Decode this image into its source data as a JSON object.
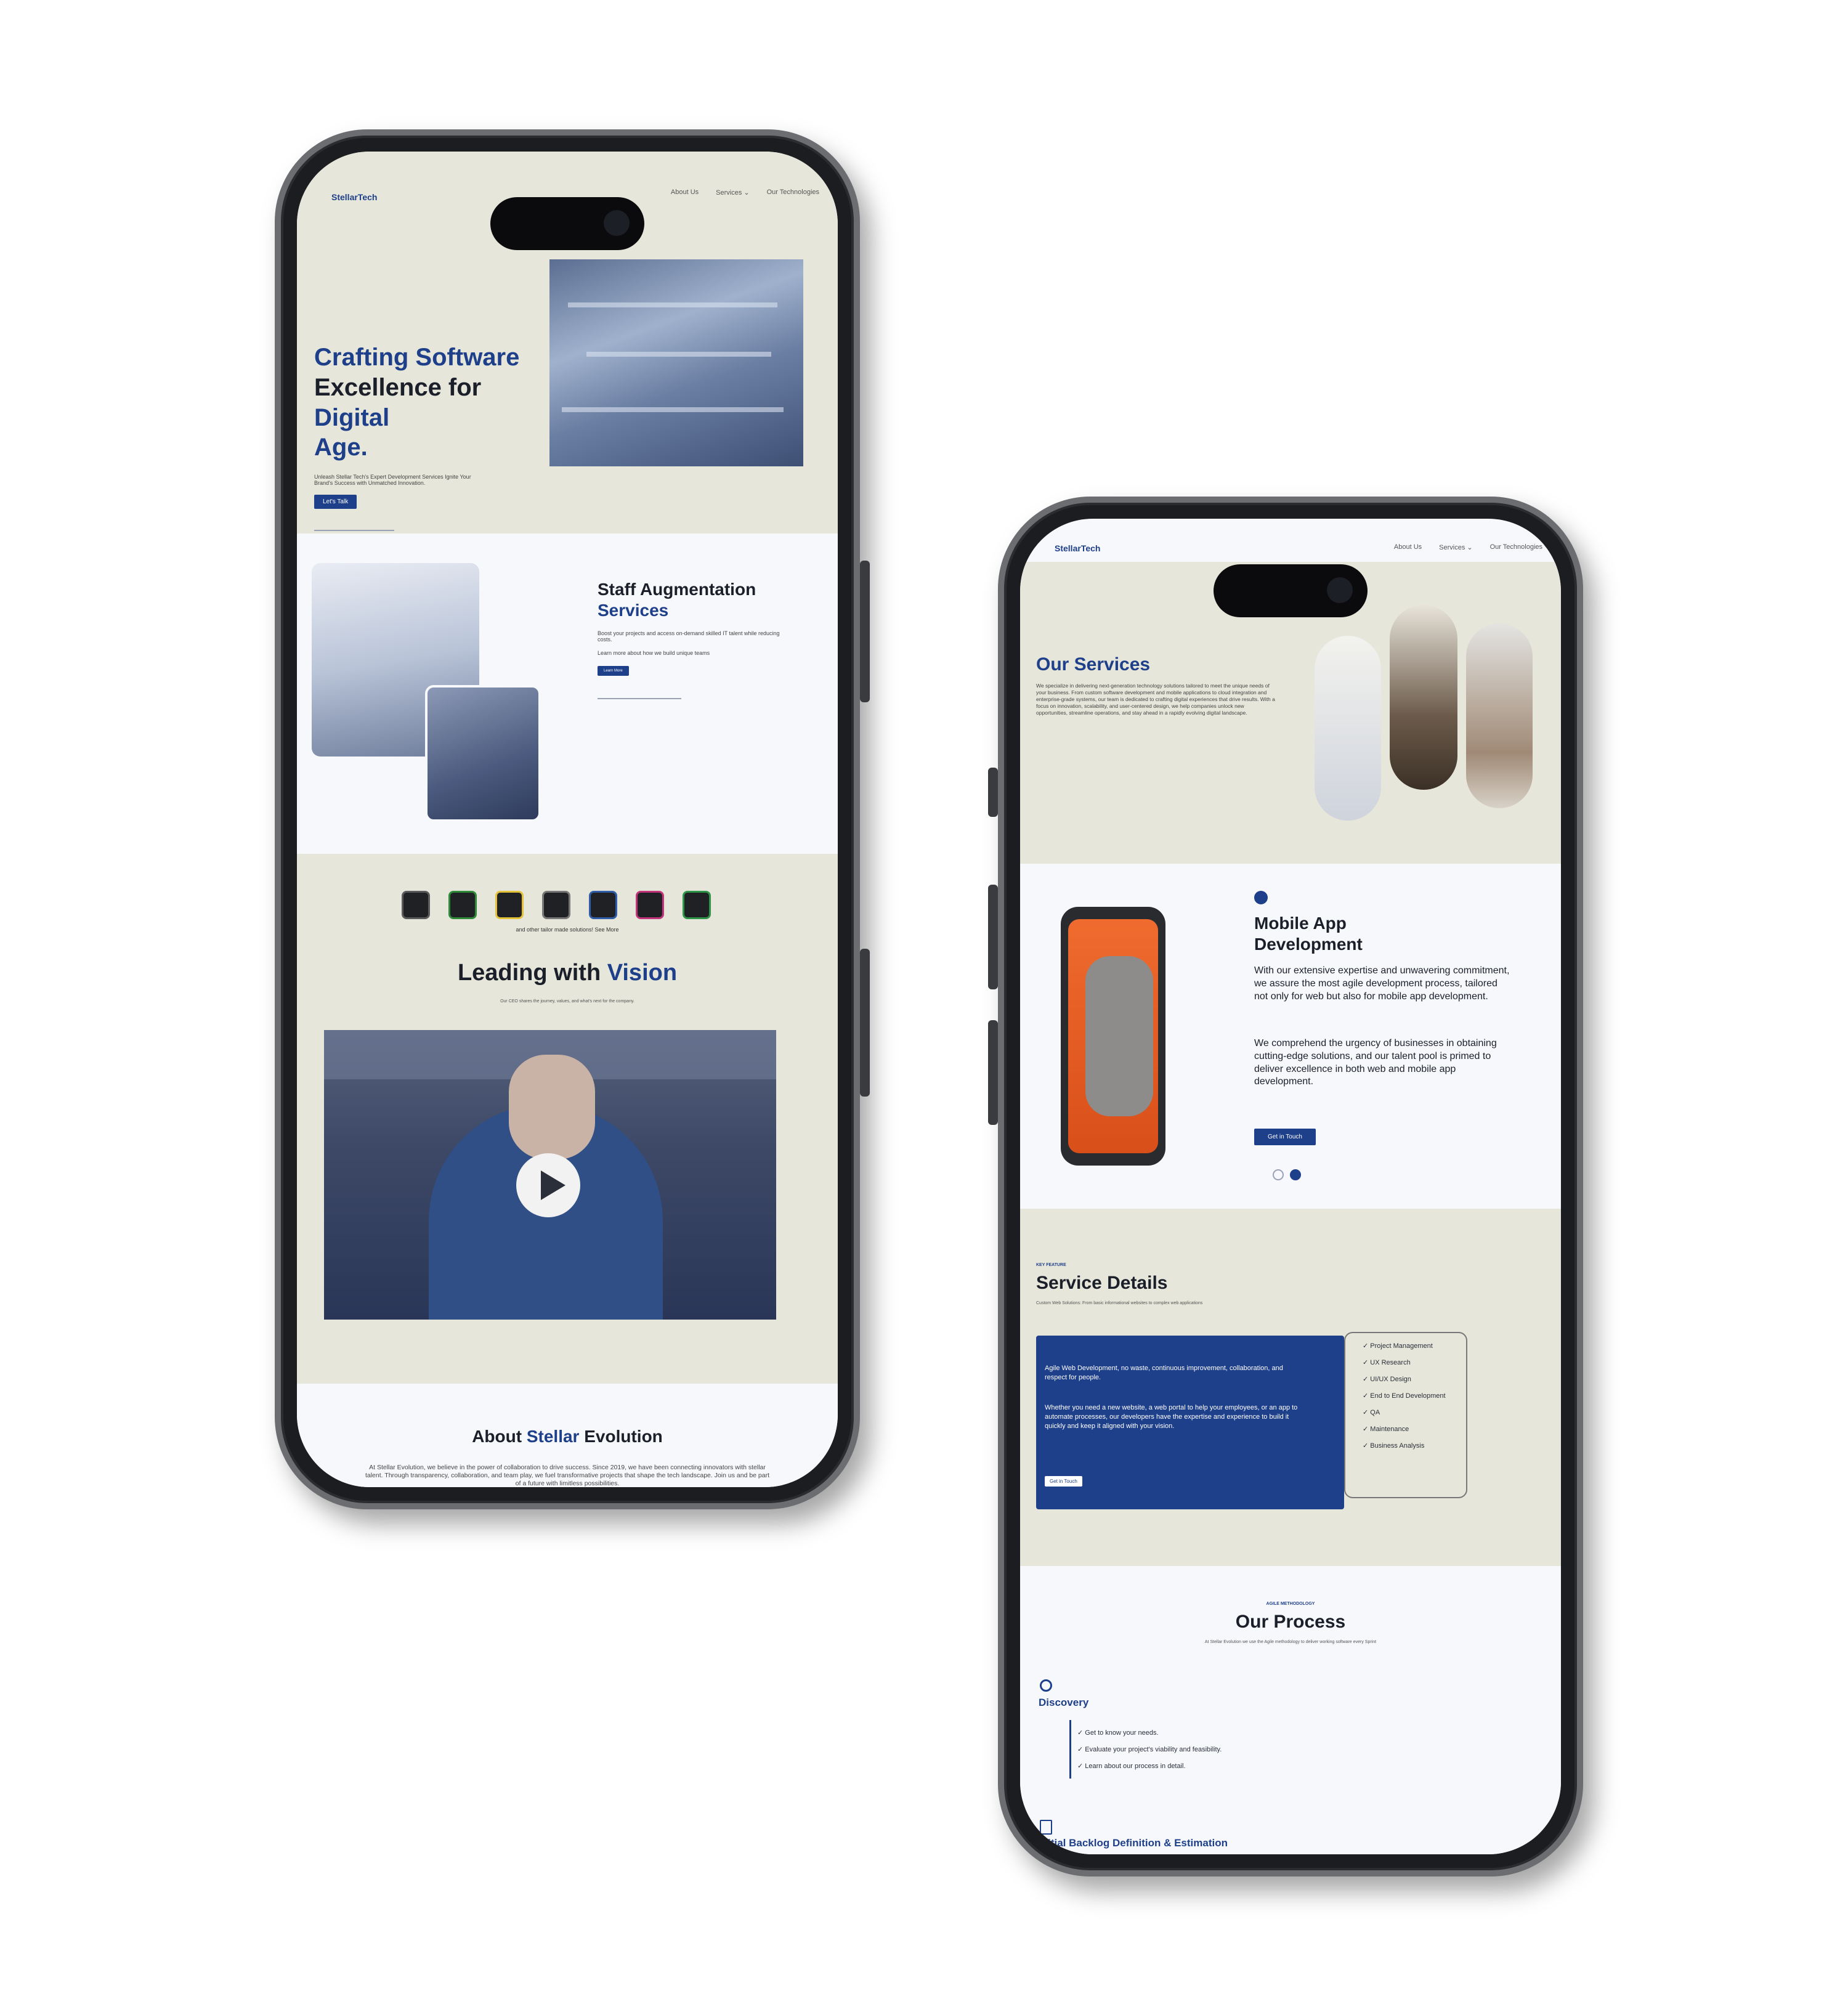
{
  "nav": {
    "logo": "StellarTech",
    "links": [
      "About Us",
      "Services ⌄",
      "Our Technologies"
    ]
  },
  "left_phone": {
    "hero": {
      "title_line1": "Crafting Software",
      "title_line2a": "Excellence for ",
      "title_line2b": "Digital",
      "title_line3": "Age.",
      "subtitle": "Unleash Stellar Tech's Expert Development Services Ignite Your Brand's Success with Unmatched Innovation.",
      "cta": "Let's Talk"
    },
    "staff": {
      "title_line1": "Staff Augmentation",
      "title_line2": "Services",
      "text": "Boost your projects and access on-demand skilled IT talent while reducing costs.",
      "link": "Learn more about how we build unique teams",
      "cta": "Learn More"
    },
    "tech": {
      "caption": "and other tailor made solutions!  See More"
    },
    "vision": {
      "title_a": "Leading with ",
      "title_b": "Vision",
      "subtitle": "Our CEO shares the journey, values, and what's next for the company."
    },
    "about": {
      "title_a": "About ",
      "title_b": "Stellar",
      "title_c": " Evolution",
      "text": "At Stellar Evolution, we believe in the power of collaboration to drive success. Since 2019, we have been connecting innovators with stellar talent. Through transparency, collaboration, and team play, we fuel transformative projects that shape the tech landscape. Join us and be part of a future with limitless possibilities."
    }
  },
  "right_phone": {
    "services": {
      "title": "Our Services",
      "text": "We specialize in delivering next-generation technology solutions tailored to meet the unique needs of your business. From custom software development and mobile applications to cloud integration and enterprise-grade systems, our team is dedicated to crafting digital experiences that drive results. With a focus on innovation, scalability, and user-centered design, we help companies unlock new opportunities, streamline operations, and stay ahead in a rapidly evolving digital landscape."
    },
    "mobile": {
      "title_line1": "Mobile App",
      "title_line2": "Development",
      "p1": "With our extensive expertise and unwavering commitment, we assure the most agile development process, tailored not only for web but also for mobile app development.",
      "p2": "We comprehend the urgency of businesses in obtaining cutting-edge solutions, and our talent pool is primed to deliver excellence in both web and mobile app development.",
      "cta": "Get in Touch"
    },
    "details": {
      "eyebrow": "KEY FEATURE",
      "title": "Service Details",
      "subtitle": "Custom Web Solutions: From basic informational websites to complex web applications",
      "card_p1": "Agile Web Development, no waste, continuous improvement, collaboration, and respect for people.",
      "card_p2": "Whether you need a new website, a web portal to help your employees, or an app to automate processes, our developers have the expertise and experience to build it quickly and keep it aligned with your vision.",
      "cta": "Get in Touch",
      "checklist": [
        "Project Management",
        "UX Research",
        "UI/UX Design",
        "End to End Development",
        "QA",
        "Maintenance",
        "Business Analysis"
      ]
    },
    "process": {
      "eyebrow": "AGILE METHODOLOGY",
      "title": "Our Process",
      "subtitle": "At Stellar Evolution we use the Agile methodology to deliver working software every Sprint",
      "step1_title": "Discovery",
      "step1_items": [
        "Get to know your needs.",
        "Evaluate your project's viability and feasibility.",
        "Learn about our process in detail."
      ],
      "step2_title": "Initial Backlog Definition & Estimation"
    }
  },
  "colors": {
    "accent": "#1e3f8a",
    "beige": "#e6e6da",
    "page": "#f7f8fb"
  }
}
